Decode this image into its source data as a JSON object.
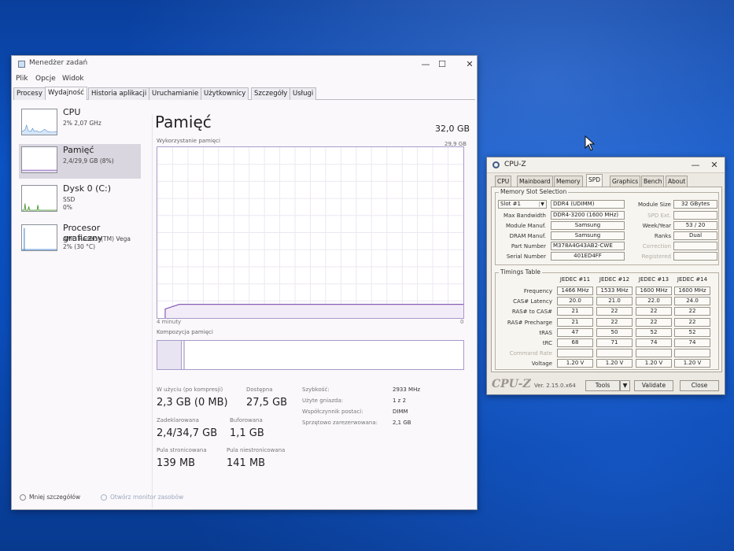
{
  "task_manager": {
    "title": "Menedżer zadań",
    "window_controls": {
      "minimize": "—",
      "maximize": "☐",
      "close": "✕"
    },
    "menu": [
      "Plik",
      "Opcje",
      "Widok"
    ],
    "tabs": [
      "Procesy",
      "Wydajność",
      "Historia aplikacji",
      "Uruchamianie",
      "Użytkownicy",
      "Szczegóły",
      "Usługi"
    ],
    "active_tab": "Wydajność",
    "sidebar": [
      {
        "name": "CPU",
        "sub1": "2% 2,07 GHz",
        "sub2": "",
        "selected": false
      },
      {
        "name": "Pamięć",
        "sub1": "2,4/29,9 GB (8%)",
        "sub2": "",
        "selected": true
      },
      {
        "name": "Dysk 0 (C:)",
        "sub1": "SSD",
        "sub2": "0%",
        "selected": false
      },
      {
        "name": "Procesor graficzny",
        "sub1": "AMD Radeon(TM) Vega",
        "sub2": "2% (30 °C)",
        "selected": false
      }
    ],
    "main": {
      "title": "Pamięć",
      "total": "32,0 GB",
      "usage_label": "Wykorzystanie pamięci",
      "usage_max": "29,9 GB",
      "axis_left": "4 minuty",
      "axis_right": "0",
      "usage_fraction": 0.08,
      "composition_label": "Kompozycja pamięci"
    },
    "stats": {
      "in_use_label": "W użyciu (po kompresji)",
      "in_use_value": "2,3 GB (0 MB)",
      "available_label": "Dostępna",
      "available_value": "27,5 GB",
      "committed_label": "Zadeklarowana",
      "committed_value": "2,4/34,7 GB",
      "cached_label": "Buforowana",
      "cached_value": "1,1 GB",
      "paged_label": "Pula stronicowana",
      "paged_value": "139 MB",
      "nonpaged_label": "Pula niestronicowana",
      "nonpaged_value": "141 MB"
    },
    "specs": [
      {
        "label": "Szybkość:",
        "value": "2933 MHz"
      },
      {
        "label": "Użyte gniazda:",
        "value": "1 z 2"
      },
      {
        "label": "Współczynnik postaci:",
        "value": "DIMM"
      },
      {
        "label": "Sprzętowo zarezerwowana:",
        "value": "2,1 GB"
      }
    ],
    "footer": {
      "fewer_details": "Mniej szczegółów",
      "open_monitor": "Otwórz monitor zasobów"
    }
  },
  "cpuz": {
    "title": "CPU-Z",
    "window_controls": {
      "minimize": "—",
      "close": "✕"
    },
    "tabs": [
      "CPU",
      "Mainboard",
      "Memory",
      "SPD",
      "Graphics",
      "Bench",
      "About"
    ],
    "active_tab": "SPD",
    "slot_group_title": "Memory Slot Selection",
    "slot": "Slot #1",
    "slot_arrow": "▼",
    "memory_type": "DDR4 (UDIMM)",
    "module_size_label": "Module Size",
    "module_size": "32 GBytes",
    "max_bandwidth_label": "Max Bandwidth",
    "max_bandwidth": "DDR4-3200 (1600 MHz)",
    "spd_ext_label": "SPD Ext.",
    "module_manuf_label": "Module Manuf.",
    "module_manuf": "Samsung",
    "week_year_label": "Week/Year",
    "week_year": "53 / 20",
    "dram_manuf_label": "DRAM Manuf.",
    "dram_manuf": "Samsung",
    "ranks_label": "Ranks",
    "ranks": "Dual",
    "part_number_label": "Part Number",
    "part_number": "M378A4G43AB2-CWE",
    "correction_label": "Correction",
    "serial_label": "Serial Number",
    "serial": "401ED4FF",
    "registered_label": "Registered",
    "timings_title": "Timings Table",
    "timing_cols": [
      "JEDEC #11",
      "JEDEC #12",
      "JEDEC #13",
      "JEDEC #14"
    ],
    "timing_rows": [
      {
        "label": "Frequency",
        "values": [
          "1466 MHz",
          "1533 MHz",
          "1600 MHz",
          "1600 MHz"
        ]
      },
      {
        "label": "CAS# Latency",
        "values": [
          "20.0",
          "21.0",
          "22.0",
          "24.0"
        ]
      },
      {
        "label": "RAS# to CAS#",
        "values": [
          "21",
          "22",
          "22",
          "22"
        ]
      },
      {
        "label": "RAS# Precharge",
        "values": [
          "21",
          "22",
          "22",
          "22"
        ]
      },
      {
        "label": "tRAS",
        "values": [
          "47",
          "50",
          "52",
          "52"
        ]
      },
      {
        "label": "tRC",
        "values": [
          "68",
          "71",
          "74",
          "74"
        ]
      },
      {
        "label": "Command Rate",
        "values": [
          "",
          "",
          "",
          ""
        ]
      },
      {
        "label": "Voltage",
        "values": [
          "1.20 V",
          "1.20 V",
          "1.20 V",
          "1.20 V"
        ]
      }
    ],
    "footer": {
      "logo": "CPU-Z",
      "version": "Ver. 2.15.0.x64",
      "tools": "Tools",
      "tools_arrow": "▼",
      "validate": "Validate",
      "close": "Close"
    }
  }
}
